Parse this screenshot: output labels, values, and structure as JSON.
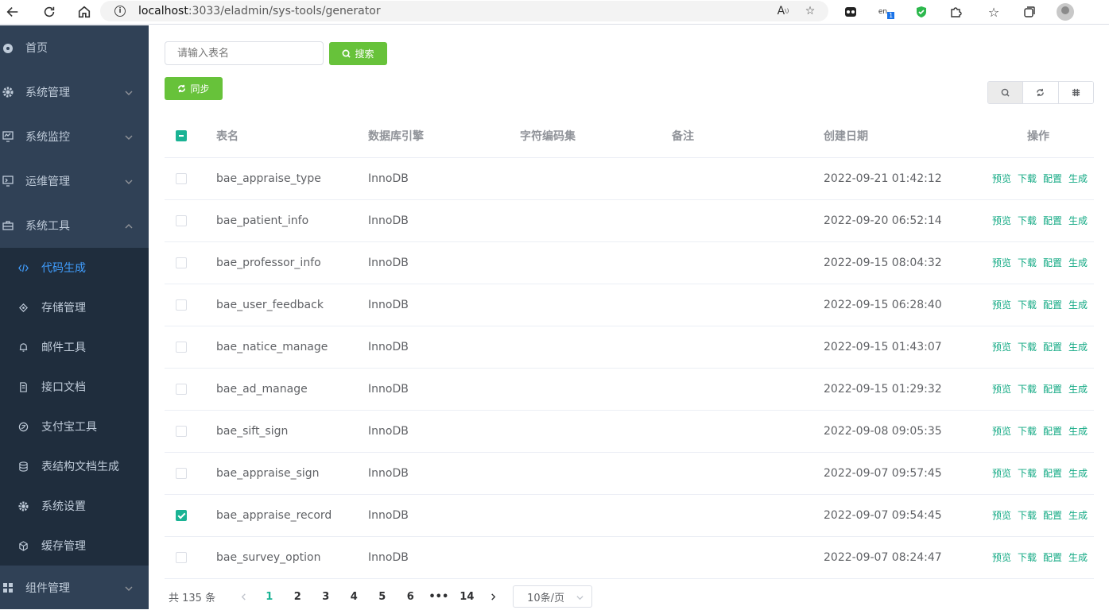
{
  "browser": {
    "url_host": "localhost",
    "url_rest": ":3033/eladmin/sys-tools/generator"
  },
  "sidebar": {
    "items": [
      {
        "label": "首页",
        "icon": "dashboard-icon",
        "expandable": false
      },
      {
        "label": "系统管理",
        "icon": "gear-icon",
        "expandable": true
      },
      {
        "label": "系统监控",
        "icon": "monitor-icon",
        "expandable": true
      },
      {
        "label": "运维管理",
        "icon": "desktop-icon",
        "expandable": true
      },
      {
        "label": "系统工具",
        "icon": "toolbox-icon",
        "expandable": true,
        "open": true
      }
    ],
    "submenu": [
      {
        "label": "代码生成",
        "icon": "code-icon",
        "active": true
      },
      {
        "label": "存储管理",
        "icon": "storage-icon",
        "active": false
      },
      {
        "label": "邮件工具",
        "icon": "bell-icon",
        "active": false
      },
      {
        "label": "接口文档",
        "icon": "document-icon",
        "active": false
      },
      {
        "label": "支付宝工具",
        "icon": "alipay-icon",
        "active": false
      },
      {
        "label": "表结构文档生成",
        "icon": "database-icon",
        "active": false
      },
      {
        "label": "系统设置",
        "icon": "gear-icon",
        "active": false
      },
      {
        "label": "缓存管理",
        "icon": "cache-icon",
        "active": false
      }
    ],
    "bottom_item": {
      "label": "组件管理",
      "icon": "components-icon"
    }
  },
  "toolbar": {
    "search_placeholder": "请输入表名",
    "search_label": "搜索",
    "sync_label": "同步"
  },
  "table": {
    "headers": {
      "name": "表名",
      "engine": "数据库引擎",
      "charset": "字符编码集",
      "remark": "备注",
      "created": "创建日期",
      "ops": "操作"
    },
    "ops_labels": {
      "preview": "预览",
      "download": "下载",
      "config": "配置",
      "generate": "生成"
    },
    "rows": [
      {
        "name": "bae_appraise_type",
        "engine": "InnoDB",
        "charset": "",
        "remark": "",
        "created": "2022-09-21 01:42:12",
        "checked": false
      },
      {
        "name": "bae_patient_info",
        "engine": "InnoDB",
        "charset": "",
        "remark": "",
        "created": "2022-09-20 06:52:14",
        "checked": false
      },
      {
        "name": "bae_professor_info",
        "engine": "InnoDB",
        "charset": "",
        "remark": "",
        "created": "2022-09-15 08:04:32",
        "checked": false
      },
      {
        "name": "bae_user_feedback",
        "engine": "InnoDB",
        "charset": "",
        "remark": "",
        "created": "2022-09-15 06:28:40",
        "checked": false
      },
      {
        "name": "bae_natice_manage",
        "engine": "InnoDB",
        "charset": "",
        "remark": "",
        "created": "2022-09-15 01:43:07",
        "checked": false
      },
      {
        "name": "bae_ad_manage",
        "engine": "InnoDB",
        "charset": "",
        "remark": "",
        "created": "2022-09-15 01:29:32",
        "checked": false
      },
      {
        "name": "bae_sift_sign",
        "engine": "InnoDB",
        "charset": "",
        "remark": "",
        "created": "2022-09-08 09:05:35",
        "checked": false
      },
      {
        "name": "bae_appraise_sign",
        "engine": "InnoDB",
        "charset": "",
        "remark": "",
        "created": "2022-09-07 09:57:45",
        "checked": false
      },
      {
        "name": "bae_appraise_record",
        "engine": "InnoDB",
        "charset": "",
        "remark": "",
        "created": "2022-09-07 09:54:45",
        "checked": true
      },
      {
        "name": "bae_survey_option",
        "engine": "InnoDB",
        "charset": "",
        "remark": "",
        "created": "2022-09-07 08:24:47",
        "checked": false
      }
    ]
  },
  "pagination": {
    "total_text": "共 135 条",
    "pages": [
      "1",
      "2",
      "3",
      "4",
      "5",
      "6",
      "•••",
      "14"
    ],
    "current": "1",
    "page_size": "10条/页"
  },
  "colors": {
    "sidebar_bg": "#304156",
    "submenu_bg": "#1f2d3d",
    "active_text": "#409eff",
    "success": "#67c23a",
    "link": "#11a983"
  }
}
